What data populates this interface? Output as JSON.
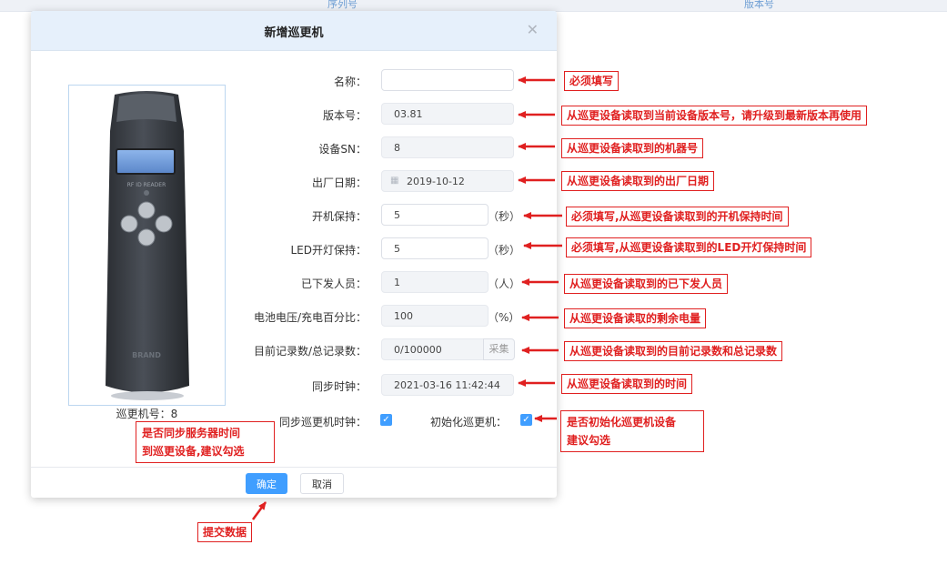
{
  "background": {
    "columns": [
      "序列号",
      "版本号"
    ]
  },
  "dialog": {
    "title": "新增巡更机",
    "close_icon": "close-icon",
    "device_caption": "巡更机号：8",
    "fields": [
      {
        "label": "名称：",
        "value": "",
        "readonly": false
      },
      {
        "label": "版本号：",
        "value": "03.81",
        "readonly": true
      },
      {
        "label": "设备SN：",
        "value": "8",
        "readonly": true
      },
      {
        "label": "出厂日期：",
        "value": "2019-10-12",
        "readonly": true
      },
      {
        "label": "开机保持：",
        "value": "5",
        "readonly": false,
        "unit": "（秒）"
      },
      {
        "label": "LED开灯保持：",
        "value": "5",
        "readonly": false,
        "unit": "（秒）"
      },
      {
        "label": "已下发人员：",
        "value": "1",
        "readonly": true,
        "unit": "（人）"
      },
      {
        "label": "电池电压/充电百分比：",
        "value": "100",
        "readonly": true,
        "unit": "（%）"
      },
      {
        "label": "目前记录数/总记录数：",
        "value": "0/100000",
        "readonly": true,
        "addon": "采集"
      },
      {
        "label": "同步时钟：",
        "value": "2021-03-16 11:42:44",
        "readonly": true
      }
    ],
    "sync_clock_label": "同步巡更机时钟：",
    "sync_clock_checked": true,
    "init_label": "初始化巡更机：",
    "init_checked": true,
    "confirm_label": "确定",
    "cancel_label": "取消"
  },
  "device": {
    "screen_text": "RF ID READER",
    "brand_text": "BRAND"
  },
  "annotations": {
    "name": "必须填写",
    "version": "从巡更设备读取到当前设备版本号，请升级到最新版本再使用",
    "sn": "从巡更设备读取到的机器号",
    "date": "从巡更设备读取到的出厂日期",
    "power_hold": "必须填写,从巡更设备读取到的开机保持时间",
    "led_hold": "必须填写,从巡更设备读取到的LED开灯保持时间",
    "people": "从巡更设备读取到的已下发人员",
    "battery": "从巡更设备读取的剩余电量",
    "records": "从巡更设备读取到的目前记录数和总记录数",
    "clock": "从巡更设备读取到的时间",
    "sync_line1": "是否同步服务器时间",
    "sync_line2": "到巡更设备,建议勾选",
    "init_line1": "是否初始化巡更机设备",
    "init_line2": "建议勾选",
    "submit": "提交数据"
  },
  "colors": {
    "primary": "#409eff",
    "annotation_red": "#e02020",
    "header_bg": "#e6f0fb"
  }
}
